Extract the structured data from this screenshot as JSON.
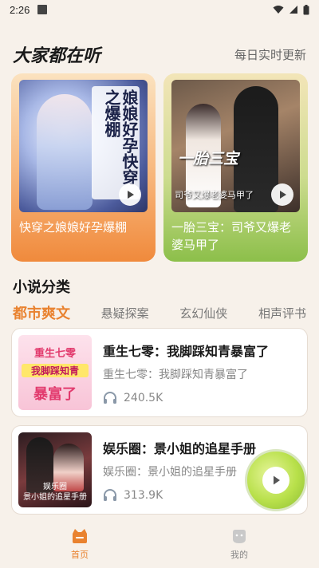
{
  "status_bar": {
    "time": "2:26"
  },
  "header": {
    "title": "大家都在听",
    "more": "每日实时更新"
  },
  "featured": [
    {
      "cover_text": "娘娘好孕快穿之爆棚",
      "title": "快穿之娘娘好孕爆棚"
    },
    {
      "cover_text": "一胎三宝",
      "cover_sub": "司爷又爆老婆马甲了",
      "title": "一胎三宝：司爷又爆老婆马甲了"
    }
  ],
  "categories": {
    "title": "小说分类",
    "tabs": [
      "都市爽文",
      "悬疑探案",
      "玄幻仙侠",
      "相声评书"
    ],
    "active_tab": "都市爽文"
  },
  "books": [
    {
      "title": "重生七零：我脚踩知青暴富了",
      "desc": "重生七零：我脚踩知青暴富了",
      "plays": "240.5K",
      "cover_lines": [
        "重生七零",
        "我脚踩知青",
        "暴富了"
      ]
    },
    {
      "title": "娱乐圈：景小姐的追星手册",
      "desc": "娱乐圈：景小姐的追星手册",
      "plays": "313.9K",
      "cover_lines": [
        "娱乐圈",
        "景小姐的追星手册"
      ]
    }
  ],
  "nav": [
    {
      "label": "首页",
      "icon": "home-cat-icon",
      "active": true
    },
    {
      "label": "我的",
      "icon": "profile-icon",
      "active": false
    }
  ],
  "colors": {
    "accent": "#e9822f",
    "background": "#f7f1ea"
  }
}
